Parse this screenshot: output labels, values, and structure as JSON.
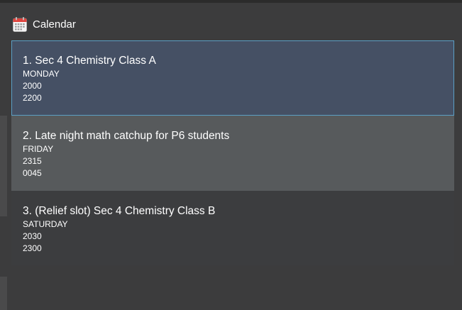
{
  "header": {
    "title": "Calendar",
    "icon": "calendar-icon"
  },
  "colors": {
    "background": "#3c3c3d",
    "selected_item": "#455064",
    "selected_border": "#5b9fc5",
    "hover_item": "#575a5c",
    "item": "#3c3d3f",
    "calendar_icon_red": "#e0443e"
  },
  "items": [
    {
      "title": "1. Sec 4 Chemistry Class A",
      "day": "MONDAY",
      "start": "2000",
      "end": "2200"
    },
    {
      "title": "2. Late night math catchup for P6 students",
      "day": "FRIDAY",
      "start": "2315",
      "end": "0045"
    },
    {
      "title": "3.  (Relief slot) Sec 4 Chemistry Class B",
      "day": "SATURDAY",
      "start": "2030",
      "end": "2300"
    }
  ]
}
